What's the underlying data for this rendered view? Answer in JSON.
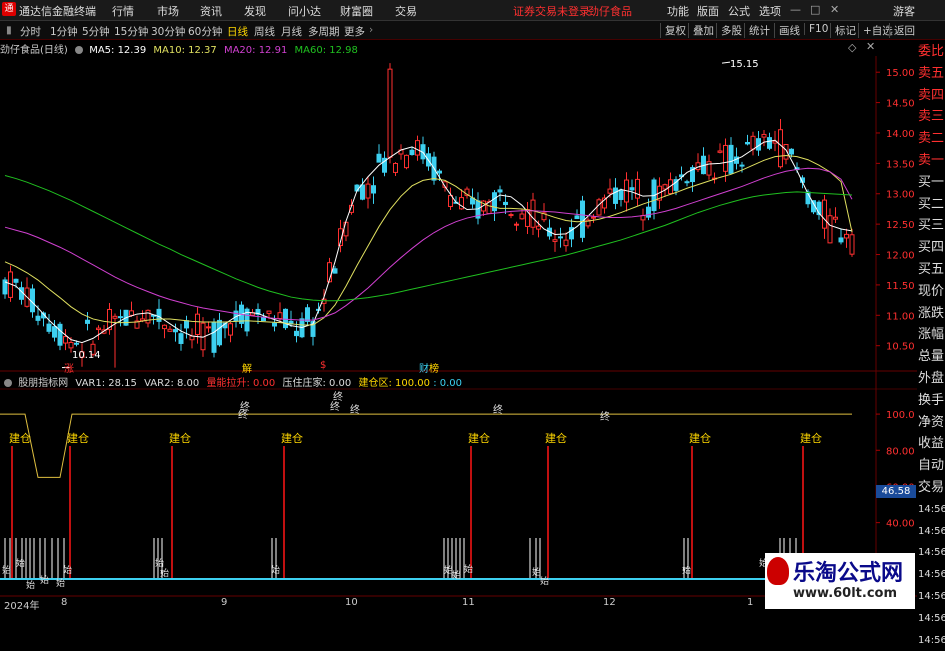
{
  "app": {
    "title": "通达信金融终端",
    "logo": "通",
    "menu": [
      "行情",
      "市场",
      "资讯",
      "发现",
      "问小达",
      "财富圈",
      "交易"
    ],
    "notice": "证券交易未登录",
    "stock_link": "劲仔食品",
    "right_menu": [
      "功能",
      "版面",
      "公式",
      "选项"
    ],
    "guest": "游客"
  },
  "periods": [
    "分时",
    "1分钟",
    "5分钟",
    "15分钟",
    "30分钟",
    "60分钟",
    "日线",
    "周线",
    "月线",
    "多周期",
    "更多"
  ],
  "active_period": "日线",
  "toolbar_right": [
    "复权",
    "叠加",
    "多股",
    "统计",
    "画线",
    "F10",
    "标记",
    "+自选",
    "返回"
  ],
  "ma": {
    "name": "劲仔食品(日线)",
    "ma5": "MA5: 12.39",
    "ma10": "MA10: 12.37",
    "ma20": "MA20: 12.91",
    "ma60": "MA60: 12.98"
  },
  "price_axis": [
    "15.00",
    "14.50",
    "14.00",
    "13.50",
    "13.00",
    "12.50",
    "12.00",
    "11.50",
    "11.00",
    "10.50"
  ],
  "annotations": {
    "high": "15.15",
    "low": "10.14",
    "marks": [
      "涨",
      "解",
      "$",
      "财",
      "榜"
    ]
  },
  "indicator": {
    "name": "股朋指标网",
    "var1": "VAR1: 28.15",
    "var2": "VAR2: 8.00",
    "k3": "量能拉升: 0.00",
    "k4": "压住庄家: 0.00",
    "k5": "建仓区: 100.00",
    "k5b": ": 0.00"
  },
  "ind_axis": [
    "100.0",
    "80.00",
    "60.00",
    "40.00",
    "20.00"
  ],
  "current_value": "46.58",
  "signals": {
    "build": "建仓",
    "end": "终",
    "start": "始"
  },
  "dates": [
    "2024年",
    "8",
    "9",
    "10",
    "11",
    "12",
    "1"
  ],
  "side_panel": [
    "委比",
    "卖五",
    "卖四",
    "卖三",
    "卖二",
    "卖一",
    "买一",
    "买二",
    "买三",
    "买四",
    "买五",
    "现价",
    "涨跌",
    "涨幅",
    "总量",
    "外盘",
    "换手",
    "净资",
    "收益",
    "自动",
    "交易",
    "14:56",
    "14:56",
    "14:56",
    "14:56",
    "14:56",
    "14:56",
    "14:56"
  ],
  "watermark": {
    "line1": "乐淘公式网",
    "line2": "www.60lt.com"
  },
  "colors": {
    "up": "#ff3030",
    "down": "#3dd0f0",
    "ma5": "#ffffff",
    "ma10": "#e0e060",
    "ma20": "#d040d0",
    "ma60": "#20c020",
    "accent": "#ffd700"
  },
  "chart_data": [
    {
      "type": "candlestick",
      "title": "劲仔食品(日线)",
      "price_range": [
        10.1,
        15.2
      ],
      "high": 15.15,
      "low": 10.14,
      "series": [
        {
          "name": "MA5",
          "value": 12.39,
          "values": [
            11.55,
            11.48,
            11.3,
            11.12,
            10.92,
            10.75,
            10.6,
            10.55,
            10.62,
            10.74,
            10.86,
            10.96,
            11.02,
            11.04,
            10.98,
            10.86,
            10.74,
            10.66,
            10.64,
            10.72,
            10.86,
            10.98,
            11.05,
            11.03,
            10.96,
            10.9,
            10.83,
            10.8,
            10.86,
            11.3,
            11.88,
            12.55,
            13.05,
            13.28,
            13.47,
            13.6,
            13.72,
            13.77,
            13.68,
            13.42,
            13.12,
            12.86,
            12.74,
            12.75,
            12.86,
            12.98,
            12.95,
            12.81,
            12.6,
            12.42,
            12.33,
            12.34,
            12.46,
            12.63,
            12.82,
            12.98,
            13.07,
            13.03,
            12.96,
            12.97,
            13.06,
            13.19,
            13.35,
            13.44,
            13.49,
            13.5,
            13.53,
            13.61,
            13.73,
            13.85,
            13.88,
            13.72,
            13.38,
            13.0,
            12.68,
            12.48,
            12.42,
            12.39
          ]
        },
        {
          "name": "MA10",
          "value": 12.37,
          "values": [
            11.88,
            11.8,
            11.7,
            11.58,
            11.43,
            11.29,
            11.14,
            11.02,
            10.94,
            10.9,
            10.88,
            10.88,
            10.89,
            10.92,
            10.94,
            10.94,
            10.92,
            10.9,
            10.89,
            10.89,
            10.89,
            10.9,
            10.91,
            10.9,
            10.89,
            10.88,
            10.86,
            10.84,
            10.84,
            10.96,
            11.17,
            11.48,
            11.82,
            12.14,
            12.46,
            12.74,
            12.96,
            13.13,
            13.22,
            13.25,
            13.22,
            13.12,
            12.99,
            12.88,
            12.8,
            12.76,
            12.76,
            12.75,
            12.72,
            12.67,
            12.61,
            12.56,
            12.54,
            12.55,
            12.58,
            12.63,
            12.69,
            12.76,
            12.83,
            12.89,
            12.96,
            13.02,
            13.09,
            13.15,
            13.21,
            13.27,
            13.32,
            13.39,
            13.47,
            13.55,
            13.61,
            13.63,
            13.61,
            13.56,
            13.47,
            13.36,
            13.2,
            12.37
          ]
        },
        {
          "name": "MA20",
          "value": 12.91,
          "values": [
            12.45,
            12.4,
            12.35,
            12.28,
            12.2,
            12.12,
            12.03,
            11.93,
            11.83,
            11.73,
            11.63,
            11.54,
            11.46,
            11.39,
            11.32,
            11.26,
            11.21,
            11.16,
            11.12,
            11.09,
            11.06,
            11.03,
            11.0,
            10.98,
            10.96,
            10.94,
            10.93,
            10.92,
            10.92,
            10.97,
            11.04,
            11.16,
            11.3,
            11.45,
            11.62,
            11.79,
            11.95,
            12.1,
            12.24,
            12.36,
            12.46,
            12.54,
            12.6,
            12.64,
            12.67,
            12.69,
            12.71,
            12.72,
            12.72,
            12.71,
            12.7,
            12.68,
            12.66,
            12.64,
            12.62,
            12.61,
            12.61,
            12.62,
            12.64,
            12.67,
            12.71,
            12.76,
            12.82,
            12.88,
            12.94,
            13.0,
            13.06,
            13.12,
            13.19,
            13.26,
            13.32,
            13.37,
            13.4,
            13.42,
            13.41,
            13.36,
            13.24,
            12.91
          ]
        },
        {
          "name": "MA60",
          "value": 12.98,
          "values": [
            13.3,
            13.25,
            13.19,
            13.12,
            13.05,
            12.97,
            12.89,
            12.8,
            12.71,
            12.62,
            12.53,
            12.44,
            12.35,
            12.26,
            12.17,
            12.09,
            12.0,
            11.92,
            11.84,
            11.76,
            11.68,
            11.6,
            11.53,
            11.46,
            11.4,
            11.35,
            11.3,
            11.27,
            11.25,
            11.24,
            11.24,
            11.25,
            11.27,
            11.29,
            11.32,
            11.35,
            11.39,
            11.43,
            11.47,
            11.51,
            11.55,
            11.59,
            11.63,
            11.67,
            11.71,
            11.75,
            11.79,
            11.83,
            11.87,
            11.91,
            11.95,
            11.99,
            12.04,
            12.09,
            12.14,
            12.19,
            12.24,
            12.3,
            12.36,
            12.42,
            12.48,
            12.55,
            12.62,
            12.69,
            12.75,
            12.81,
            12.86,
            12.91,
            12.95,
            12.98,
            13.0,
            13.02,
            13.03,
            13.02,
            13.01,
            13.0,
            12.99,
            12.98
          ]
        }
      ]
    },
    {
      "type": "line",
      "title": "股朋指标网",
      "ylim": [
        0,
        110
      ],
      "series": [
        {
          "name": "建仓区",
          "value": 100.0
        },
        {
          "name": "VAR1",
          "value": 28.15
        },
        {
          "name": "VAR2",
          "value": 8.0
        }
      ]
    }
  ]
}
